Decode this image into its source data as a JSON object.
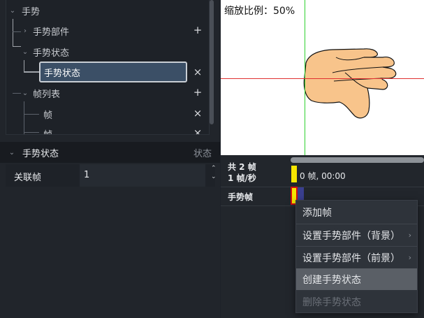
{
  "tree": {
    "root": "手势",
    "parts": "手势部件",
    "states": "手势状态",
    "selected_state": "手势状态",
    "frames": "帧列表",
    "frame1": "帧",
    "frame2": "帧",
    "add": "+",
    "remove": "×",
    "collapse_open": "⌄",
    "collapse_closed": "›"
  },
  "props": {
    "header": "手势状态",
    "header_right": "状态",
    "field_label": "关联帧",
    "field_value": "1",
    "spin_up": "⌃",
    "spin_down": "⌄"
  },
  "canvas": {
    "zoom": "缩放比例：50%",
    "hand_color": "#f8c48b",
    "outline_color": "#111111"
  },
  "timeline": {
    "total": "共 2 帧",
    "fps": "1 帧/秒",
    "current": "0 帧, 00:00",
    "track": "手势帧"
  },
  "menu": {
    "items": [
      {
        "label": "添加帧",
        "submenu": false,
        "state": "normal"
      },
      {
        "label": "设置手势部件（背景）",
        "submenu": true,
        "state": "normal"
      },
      {
        "label": "设置手势部件（前景）",
        "submenu": true,
        "state": "normal"
      },
      {
        "label": "创建手势状态",
        "submenu": false,
        "state": "hover"
      },
      {
        "label": "删除手势状态",
        "submenu": false,
        "state": "disabled"
      }
    ],
    "arrow": "›"
  },
  "colors": {
    "accent": "#3b4f66",
    "marker_yellow": "#f7e600",
    "marker_blue": "#3a3f8f",
    "crosshair_v": "#2fd12f",
    "crosshair_h": "#e03030"
  }
}
